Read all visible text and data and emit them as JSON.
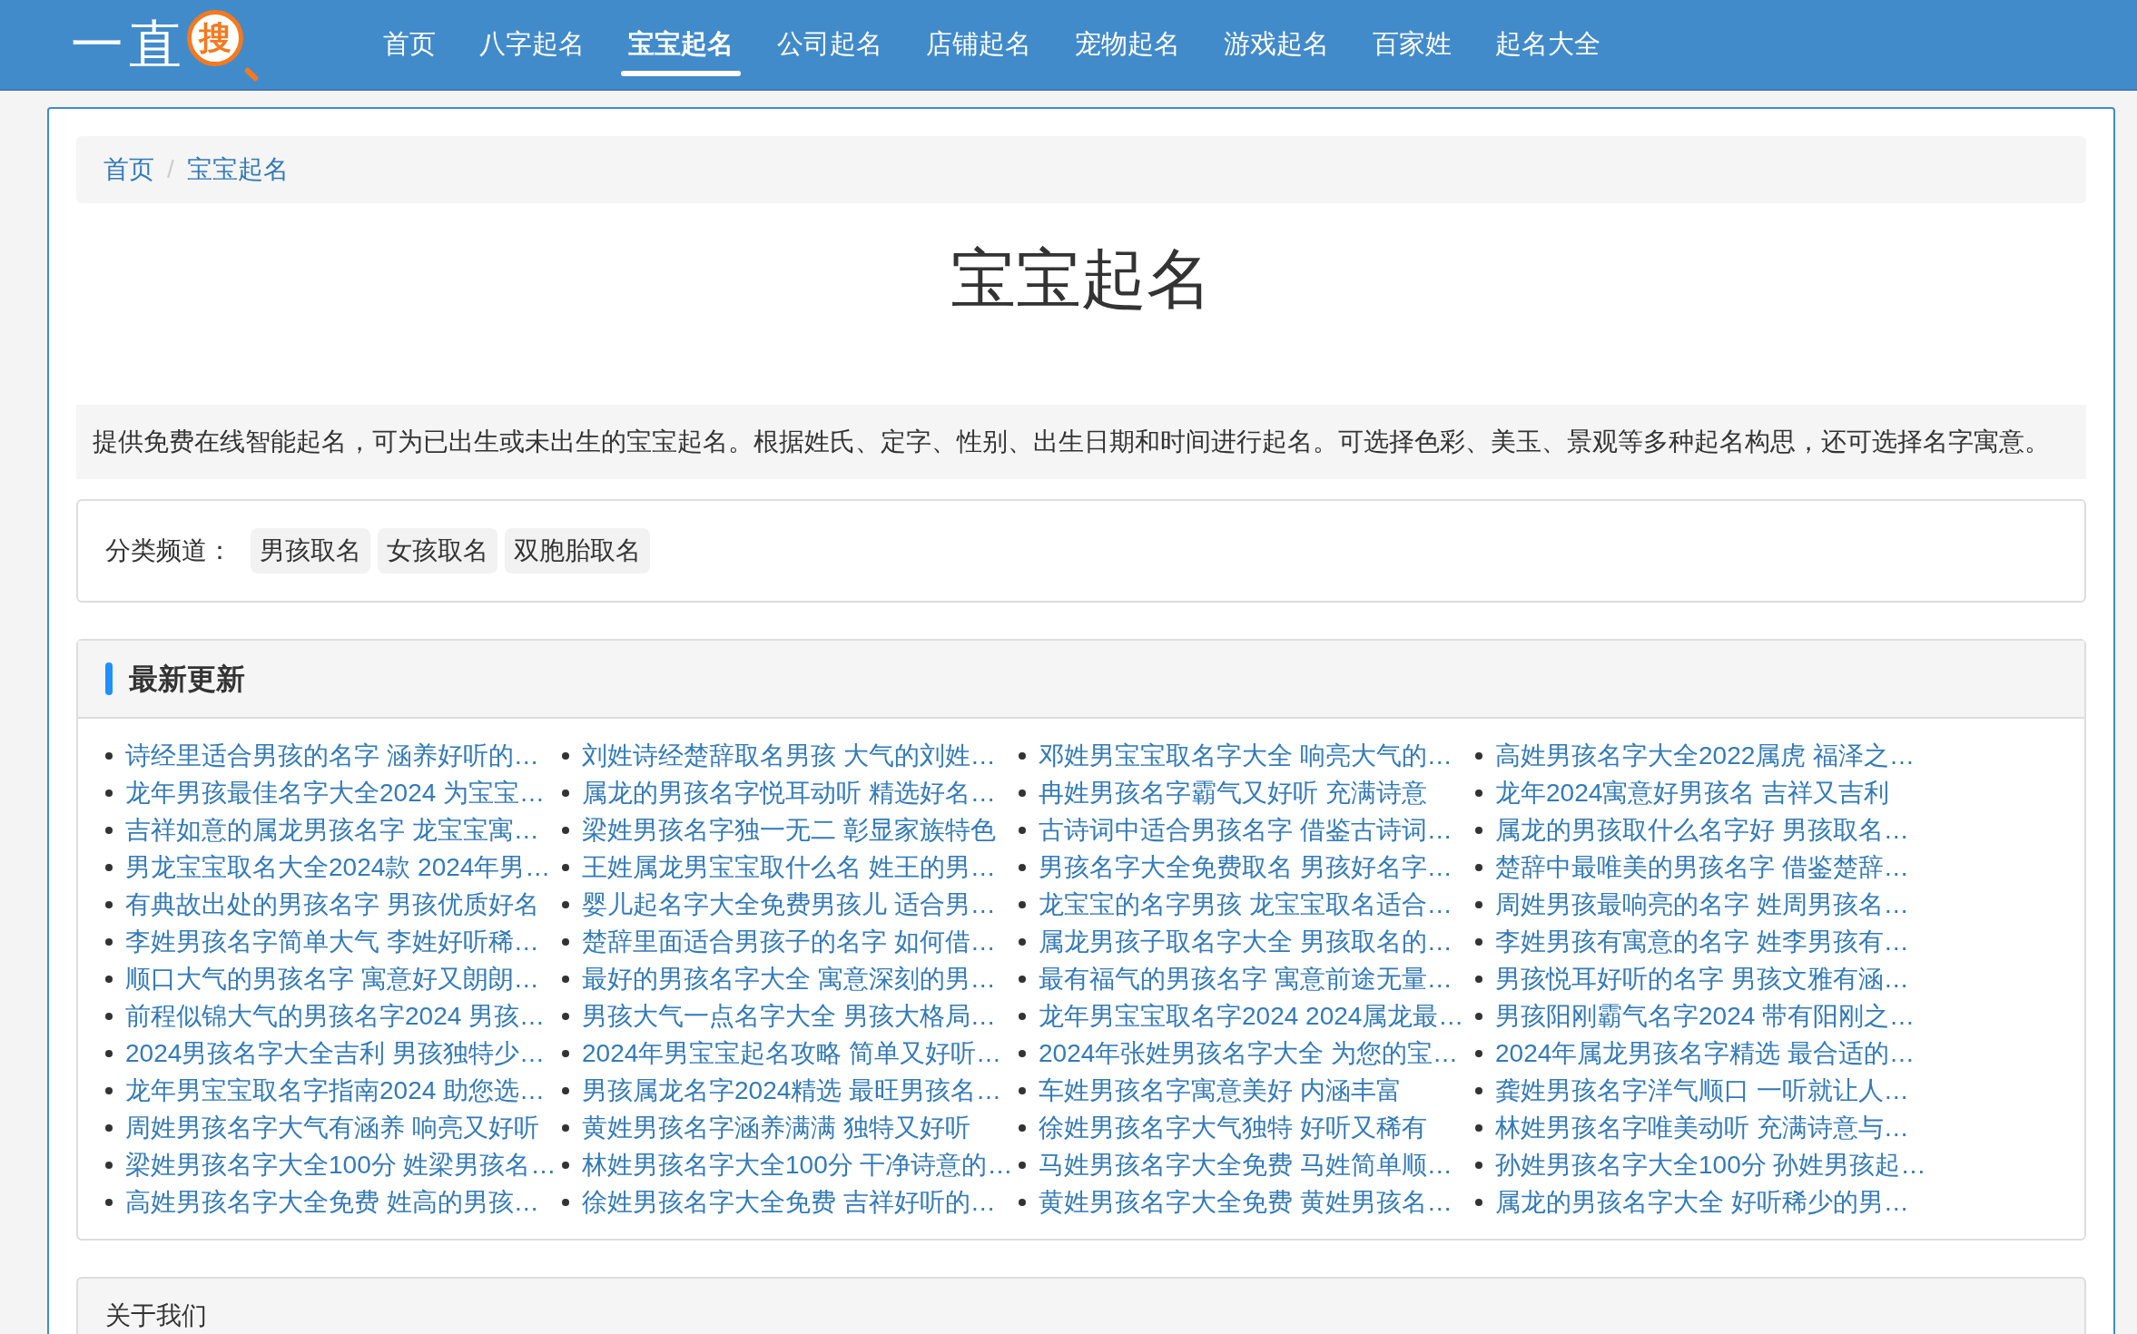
{
  "logo": {
    "text": "一直",
    "badge": "搜"
  },
  "nav": [
    {
      "label": "首页",
      "selected": false
    },
    {
      "label": "八字起名",
      "selected": false
    },
    {
      "label": "宝宝起名",
      "selected": true
    },
    {
      "label": "公司起名",
      "selected": false
    },
    {
      "label": "店铺起名",
      "selected": false
    },
    {
      "label": "宠物起名",
      "selected": false
    },
    {
      "label": "游戏起名",
      "selected": false
    },
    {
      "label": "百家姓",
      "selected": false
    },
    {
      "label": "起名大全",
      "selected": false
    }
  ],
  "breadcrumb": [
    "首页",
    "宝宝起名"
  ],
  "breadcrumb_separator": "/",
  "title": "宝宝起名",
  "description": "提供免费在线智能起名，可为已出生或未出生的宝宝起名。根据姓氏、定字、性别、出生日期和时间进行起名。可选择色彩、美玉、景观等多种起名构思，还可选择名字寓意。",
  "categories": {
    "label": "分类频道：",
    "items": [
      "男孩取名",
      "女孩取名",
      "双胞胎取名"
    ]
  },
  "latest": {
    "title": "最新更新",
    "items": [
      "诗经里适合男孩的名字 涵养好听的…",
      "刘姓诗经楚辞取名男孩 大气的刘姓…",
      "邓姓男宝宝取名字大全 响亮大气的…",
      "高姓男孩名字大全2022属虎 福泽之…",
      "龙年男孩最佳名字大全2024 为宝宝…",
      "属龙的男孩名字悦耳动听 精选好名…",
      "冉姓男孩名字霸气又好听 充满诗意",
      "龙年2024寓意好男孩名 吉祥又吉利",
      "吉祥如意的属龙男孩名字 龙宝宝寓…",
      "梁姓男孩名字独一无二 彰显家族特色",
      "古诗词中适合男孩名字 借鉴古诗词…",
      "属龙的男孩取什么名字好 男孩取名…",
      "男龙宝宝取名大全2024款 2024年男…",
      "王姓属龙男宝宝取什么名 姓王的男…",
      "男孩名字大全免费取名 男孩好名字…",
      "楚辞中最唯美的男孩名字 借鉴楚辞…",
      "有典故出处的男孩名字 男孩优质好名",
      "婴儿起名字大全免费男孩儿 适合男…",
      "龙宝宝的名字男孩 龙宝宝取名适合…",
      "周姓男孩最响亮的名字 姓周男孩名…",
      "李姓男孩名字简单大气 李姓好听稀…",
      "楚辞里面适合男孩子的名字 如何借…",
      "属龙男孩子取名字大全 男孩取名的…",
      "李姓男孩有寓意的名字 姓李男孩有…",
      "顺口大气的男孩名字 寓意好又朗朗…",
      "最好的男孩名字大全 寓意深刻的男…",
      "最有福气的男孩名字 寓意前途无量…",
      "男孩悦耳好听的名字 男孩文雅有涵…",
      "前程似锦大气的男孩名字2024 男孩…",
      "男孩大气一点名字大全 男孩大格局…",
      "龙年男宝宝取名字2024 2024属龙最…",
      "男孩阳刚霸气名字2024 带有阳刚之…",
      "2024男孩名字大全吉利 男孩独特少…",
      "2024年男宝宝起名攻略 简单又好听…",
      "2024年张姓男孩名字大全 为您的宝…",
      "2024年属龙男孩名字精选 最合适的…",
      "龙年男宝宝取名字指南2024 助您选…",
      "男孩属龙名字2024精选 最旺男孩名…",
      "车姓男孩名字寓意美好 内涵丰富",
      "龚姓男孩名字洋气顺口 一听就让人…",
      "周姓男孩名字大气有涵养 响亮又好听",
      "黄姓男孩名字涵养满满 独特又好听",
      "徐姓男孩名字大气独特 好听又稀有",
      "林姓男孩名字唯美动听 充满诗意与…",
      "梁姓男孩名字大全100分 姓梁男孩名…",
      "林姓男孩名字大全100分 干净诗意的…",
      "马姓男孩名字大全免费 马姓简单顺…",
      "孙姓男孩名字大全100分 孙姓男孩起…",
      "高姓男孩名字大全免费 姓高的男孩…",
      "徐姓男孩名字大全免费 吉祥好听的…",
      "黄姓男孩名字大全免费 黄姓男孩名…",
      "属龙的男孩名字大全 好听稀少的男…"
    ]
  },
  "about": {
    "title": "关于我们"
  }
}
